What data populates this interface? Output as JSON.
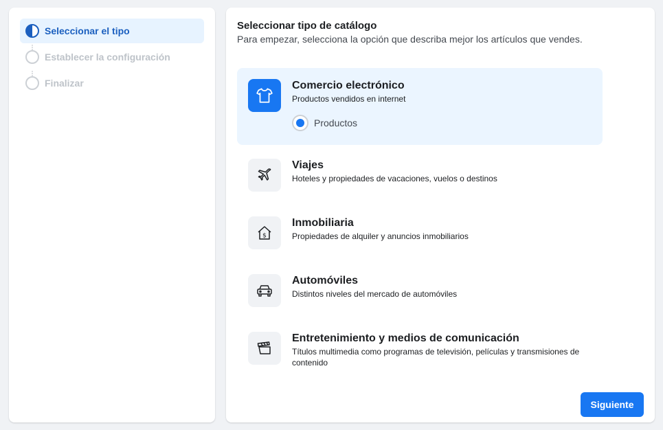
{
  "steps": [
    {
      "label": "Seleccionar el tipo",
      "state": "active"
    },
    {
      "label": "Establecer la configuración",
      "state": "inactive"
    },
    {
      "label": "Finalizar",
      "state": "inactive"
    }
  ],
  "main": {
    "title": "Seleccionar tipo de catálogo",
    "subtitle": "Para empezar, selecciona la opción que describa mejor los artículos que vendes."
  },
  "options": [
    {
      "title": "Comercio electrónico",
      "desc": "Productos vendidos en internet",
      "icon": "shirt-icon",
      "selected": true,
      "radio_label": "Productos"
    },
    {
      "title": "Viajes",
      "desc": "Hoteles y propiedades de vacaciones, vuelos o destinos",
      "icon": "airplane-icon"
    },
    {
      "title": "Inmobiliaria",
      "desc": "Propiedades de alquiler y anuncios inmobiliarios",
      "icon": "house-dollar-icon"
    },
    {
      "title": "Automóviles",
      "desc": "Distintos niveles del mercado de automóviles",
      "icon": "car-icon"
    },
    {
      "title": "Entretenimiento y medios de comunicación",
      "desc": "Títulos multimedia como programas de televisión, películas y transmisiones de contenido",
      "icon": "clapperboard-icon"
    }
  ],
  "footer": {
    "next_label": "Siguiente"
  },
  "colors": {
    "accent": "#1877f2",
    "active_step": "#1b5fbf",
    "selected_bg": "#ebf5ff"
  }
}
